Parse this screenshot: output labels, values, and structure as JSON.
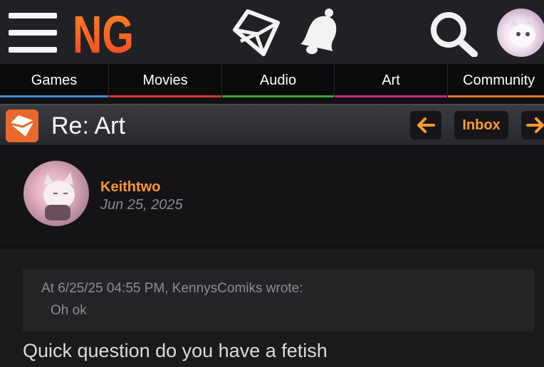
{
  "header": {
    "logo_text": "NG",
    "icons": [
      "menu-icon",
      "envelope-icon",
      "bell-icon",
      "search-icon"
    ]
  },
  "nav": {
    "items": [
      {
        "label": "Games",
        "color": "#3b8fd9"
      },
      {
        "label": "Movies",
        "color": "#d23b3b"
      },
      {
        "label": "Audio",
        "color": "#3aa53a"
      },
      {
        "label": "Art",
        "color": "#c4307e"
      },
      {
        "label": "Community",
        "color": "#e87a24"
      }
    ]
  },
  "titlebar": {
    "title": "Re: Art",
    "inbox_label": "Inbox"
  },
  "post": {
    "username": "Keithtwo",
    "date": "Jun 25, 2025",
    "quote_header": "At 6/25/25 04:55 PM, KennysComiks wrote:",
    "quote_text": "Oh ok",
    "message": "Quick question do you have a fetish"
  },
  "colors": {
    "accent": "#ff9a2e",
    "topbar": "#202124",
    "background": "#111013"
  }
}
